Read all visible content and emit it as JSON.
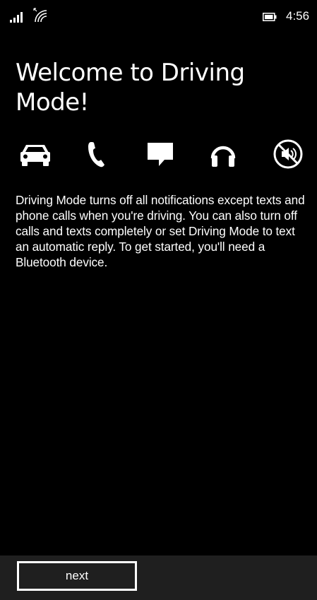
{
  "status_bar": {
    "time": "4:56",
    "signal_icon": "signal-bars-icon",
    "wifi_icon": "wifi-icon",
    "battery_icon": "battery-icon"
  },
  "title": "Welcome to Driving Mode!",
  "feature_icons": [
    "car-icon",
    "phone-icon",
    "message-icon",
    "headphones-icon",
    "mute-icon"
  ],
  "description": "Driving Mode turns off all notifications except texts and phone calls when you're driving. You can also turn off calls and texts completely or set Driving Mode to text an automatic reply. To get started, you'll need a Bluetooth device.",
  "app_bar": {
    "next_label": "next"
  },
  "colors": {
    "background": "#000000",
    "text": "#ffffff",
    "app_bar": "#1f1f1f"
  }
}
